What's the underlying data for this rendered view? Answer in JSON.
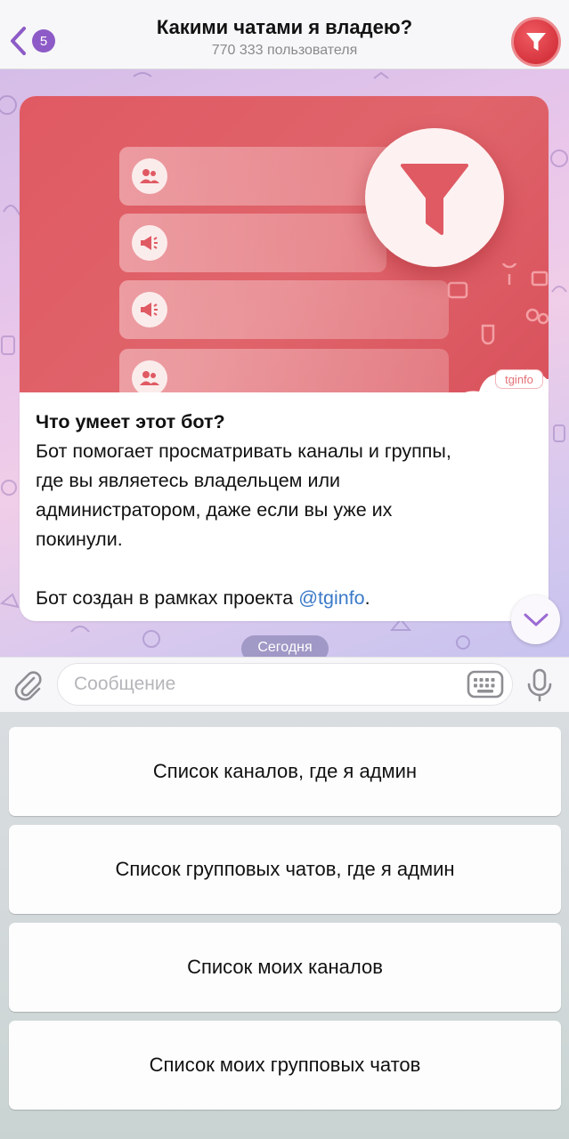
{
  "header": {
    "back_badge": "5",
    "title": "Какими чатами я владею?",
    "subtitle": "770 333 пользователя"
  },
  "message": {
    "banner_brand": "tginfo",
    "heading": "Что умеет этот бот?",
    "lines": [
      "Бот помогает просматривать каналы и группы,",
      "где вы являетесь владельцем или",
      "администратором, даже если вы уже их",
      "покинули."
    ],
    "footer_prefix": "Бот создан в рамках проекта ",
    "footer_link": "@tginfo",
    "footer_suffix": "."
  },
  "date_chip": "Сегодня",
  "input": {
    "placeholder": "Сообщение"
  },
  "keyboard": {
    "buttons": [
      "Список каналов, где я админ",
      "Список групповых чатов, где я админ",
      "Список моих каналов",
      "Список моих групповых чатов"
    ]
  },
  "colors": {
    "accent": "#8d5bc7",
    "link": "#3a79c9",
    "banner": "#e05a63",
    "avatar": "#d6353e"
  },
  "icons": {
    "back": "chevron-left-icon",
    "avatar": "funnel-icon",
    "attach": "paperclip-icon",
    "keyboard": "keyboard-icon",
    "mic": "microphone-icon",
    "scroll": "chevron-down-icon"
  }
}
